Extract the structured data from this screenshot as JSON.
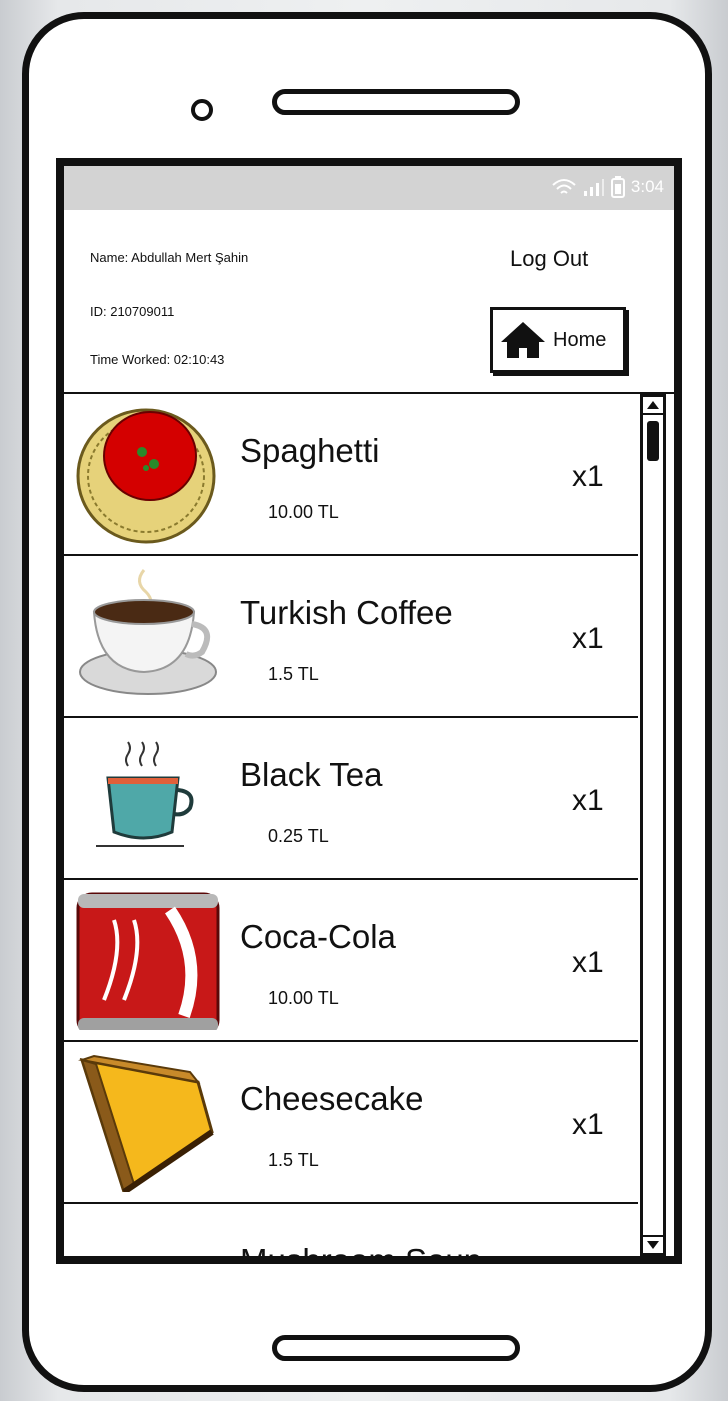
{
  "status_bar": {
    "time": "3:04",
    "icons": [
      "wifi-icon",
      "signal-icon",
      "battery-icon"
    ]
  },
  "user": {
    "name": "Name: Abdullah Mert Şahin",
    "id": "ID: 210709011",
    "time_worked": "Time Worked: 02:10:43"
  },
  "header": {
    "logout_label": "Log Out",
    "home_label": "Home",
    "home_icon": "house-icon"
  },
  "order_items": [
    {
      "name": "Spaghetti",
      "price": "10.00 TL",
      "qty": "x1",
      "icon": "spaghetti-image"
    },
    {
      "name": "Turkish Coffee",
      "price": "1.5 TL",
      "qty": "x1",
      "icon": "coffee-cup-image"
    },
    {
      "name": "Black Tea",
      "price": "0.25 TL",
      "qty": "x1",
      "icon": "tea-cup-image"
    },
    {
      "name": "Coca-Cola",
      "price": "10.00 TL",
      "qty": "x1",
      "icon": "cola-can-image"
    },
    {
      "name": "Cheesecake",
      "price": "1.5 TL",
      "qty": "x1",
      "icon": "cheesecake-image"
    },
    {
      "name": "Mushroom Soup",
      "price": "",
      "qty": "",
      "icon": ""
    }
  ]
}
